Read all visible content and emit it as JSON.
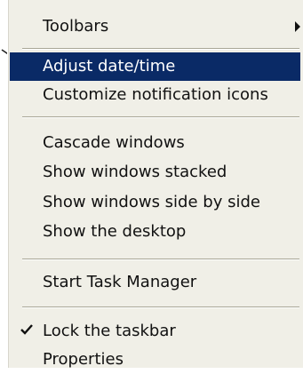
{
  "menu": {
    "items": [
      {
        "label": "Toolbars",
        "has_submenu": true
      },
      {
        "label": "Adjust date/time",
        "highlighted": true
      },
      {
        "label": "Customize notification icons"
      },
      {
        "label": "Cascade windows"
      },
      {
        "label": "Show windows stacked"
      },
      {
        "label": "Show windows side by side"
      },
      {
        "label": "Show the desktop"
      },
      {
        "label": "Start Task Manager"
      },
      {
        "label": "Lock the taskbar",
        "checked": true
      },
      {
        "label": "Properties"
      }
    ]
  },
  "icons": {
    "pointer": "pointer-arrow-icon",
    "submenu": "chevron-right-icon",
    "check": "checkmark-icon"
  },
  "colors": {
    "menu_background": "#f0efe7",
    "highlight_background": "#0a2a66",
    "highlight_text": "#ffffff",
    "text": "#111111",
    "separator": "#a9a797"
  }
}
